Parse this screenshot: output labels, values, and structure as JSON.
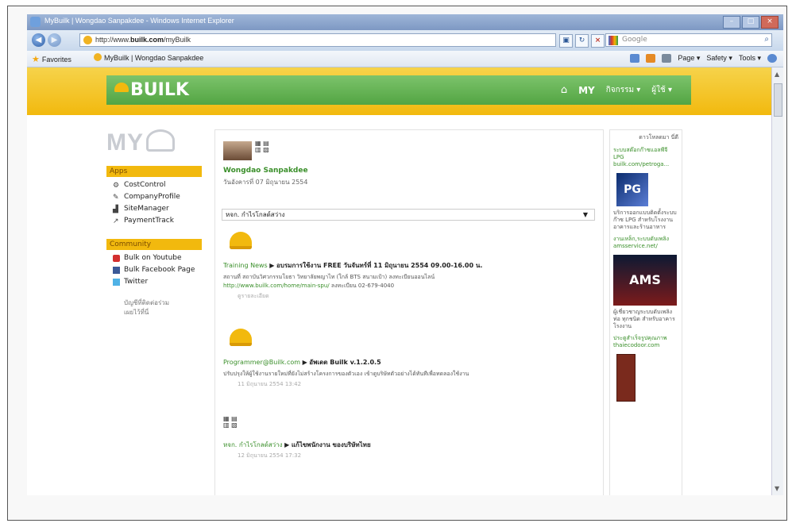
{
  "browser": {
    "window_title": "MyBuilk | Wongdao Sanpakdee - Windows Internet Explorer",
    "url_prefix": "http://www.",
    "url_domain": "builk.com",
    "url_path": "/myBuilk",
    "search_placeholder": "Google",
    "favorites_label": "Favorites",
    "tab_title": "MyBuilk | Wongdao Sanpakdee",
    "commands": [
      "Page ▾",
      "Safety ▾",
      "Tools ▾"
    ]
  },
  "site": {
    "logo_text": "BUILK",
    "nav": {
      "my": "MY",
      "item1": "กิจกรรม ▾",
      "item2": "ผู้ใช้ ▾"
    }
  },
  "sidebar": {
    "my_logo": "MY",
    "apps_header": "Apps",
    "apps": [
      {
        "label": "CostControl",
        "icon": "cost-icon"
      },
      {
        "label": "CompanyProfile",
        "icon": "profile-icon"
      },
      {
        "label": "SiteManager",
        "icon": "site-icon"
      },
      {
        "label": "PaymentTrack",
        "icon": "payment-icon"
      }
    ],
    "community_header": "Community",
    "community": [
      {
        "label": "Bulk on Youtube",
        "icon": "youtube-icon"
      },
      {
        "label": "Bulk Facebook Page",
        "icon": "facebook-icon"
      },
      {
        "label": "Twitter",
        "icon": "twitter-icon"
      }
    ],
    "note_line1": "บัญชีที่ติดต่อร่วม",
    "note_line2": "เผยไว้ที่นี่"
  },
  "feed": {
    "user_name": "Wongdao Sanpakdee",
    "date": "วันอังคารที่ 07 มิถุนายน 2554",
    "filter_value": "หจก. กำไรโกลด์สว่าง",
    "posts": [
      {
        "source": "Training News",
        "title": "อบรมการใช้งาน FREE วันจันทร์ที่ 11 มิถุนายน 2554 09.00-16.00 น.",
        "body_line1": "สถานที่ สถาบันวิศวกรรมโยธา วิทยาลัยพญาไท (ใกล้ BTS สนามเป้า) ลงทะเบียนออนไลน์",
        "body_link": "http://www.builk.com/home/main-spu/",
        "body_line2": "ลงทะเบียน 02-679-4040",
        "meta": "ดูรายละเอียด"
      },
      {
        "source": "Programmer@Builk.com",
        "title": "อัพเดต Builk v.1.2.0.5",
        "body_line1": "ปรับปรุงให้ผู้ใช้งานรายใหม่ที่ยังไม่สร้างโครงการของตัวเอง เข้าดูบริษัทตัวอย่างได้ทันทีเพื่อทดลองใช้งาน",
        "meta": "11 มิถุนายน 2554 13:42"
      },
      {
        "source": "หจก. กำไรโกลด์สว่าง",
        "title": "แก้ไขพนักงาน ของบริษัทไทย",
        "meta": "12 มิถุนายน 2554 17:32"
      }
    ]
  },
  "rightcol": {
    "header": "ดาวโหลดมา นี่ดี",
    "ad1_link": "ระบบสต๊อกก๊าซแอลพีจี LPG builk.com/petroga...",
    "ad1_image_text": "PG",
    "ad1_text": "บริการออกแบบติดตั้งระบบก๊าซ LPG สำหรับโรงงาน อาคารและร้านอาหาร",
    "ad2_link": "งานเหล็ก,ระบบดับเพลิง amsservice.net/",
    "ad2_image_text": "AMS",
    "ad2_text": "ผู้เชี่ยวชาญระบบดับเพลิง ท่อ ทุกชนิด สำหรับอาคารโรงงาน",
    "ad3_link": "ประตูสำเร็จรูปคุณภาพ thaiecodoor.com"
  },
  "colors": {
    "builk_green": "#53a543",
    "builk_yellow": "#f2b90e",
    "link_green": "#3a8f2a"
  }
}
